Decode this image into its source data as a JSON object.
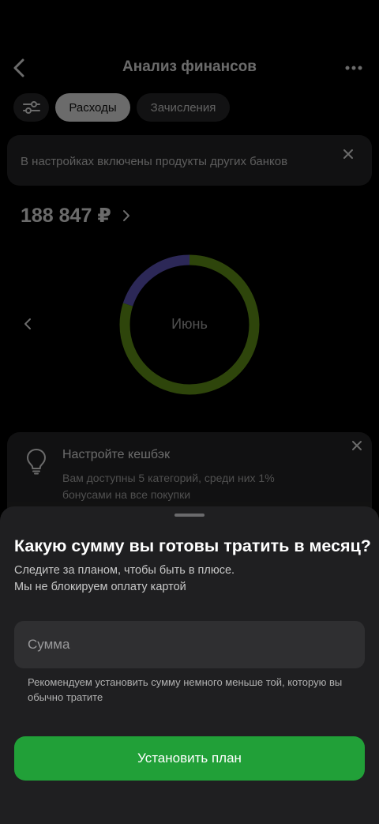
{
  "header": {
    "title": "Анализ финансов",
    "back_icon": "chevron-left-icon",
    "more_icon": "more-horizontal-icon"
  },
  "chips": {
    "filter_icon": "sliders-icon",
    "active_label": "Расходы",
    "inactive_label": "Зачисления"
  },
  "notice": {
    "text": "В настройках включены продукты других банков",
    "close_icon": "close-icon"
  },
  "summary": {
    "total": "188 847 ₽"
  },
  "donut": {
    "label": "Июнь",
    "segments": [
      {
        "color": "#6fa51b",
        "fraction": 0.8
      },
      {
        "color": "#6a5fd0",
        "fraction": 0.2
      }
    ]
  },
  "tip": {
    "title": "Настройте кешбэк",
    "text": "Вам доступны 5 категорий, среди них 1% бонусами на все покупки",
    "icon": "lightbulb-icon"
  },
  "sheet": {
    "title": "Какую сумму вы готовы тратить в месяц?",
    "desc_line1": "Следите за планом, чтобы быть в плюсе.",
    "desc_line2": "Мы не блокируем оплату картой",
    "amount_placeholder": "Сумма",
    "amount_value": "",
    "hint": "Рекомендуем установить сумму немного меньше той, которую вы обычно тратите",
    "button_label": "Установить план",
    "button_color": "#21a038"
  }
}
